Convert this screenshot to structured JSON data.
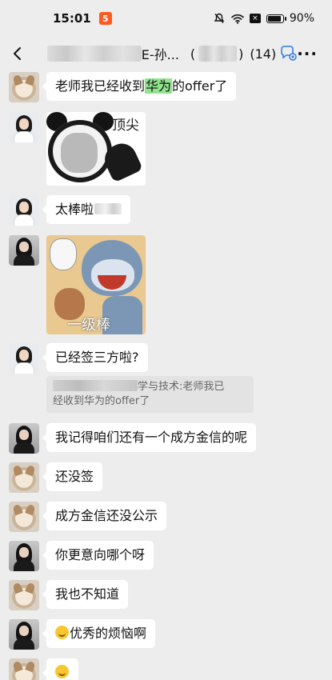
{
  "status_bar": {
    "time": "15:01",
    "app_badge": "5",
    "battery": "90%",
    "battery_level": 0.9,
    "x_glyph": "×"
  },
  "header": {
    "title": "E-孙...",
    "open_paren": "(",
    "close_paren": ")",
    "member_count": "(14)",
    "more": "···"
  },
  "messages": {
    "m1": {
      "before": "老师我已经收到",
      "highlight": "华为",
      "after": "的offer了"
    },
    "m2": {
      "sticker_caption": "顶尖"
    },
    "m3": {
      "text": "太棒啦"
    },
    "m4": {
      "sticker_caption": "一级棒"
    },
    "m5": {
      "text": "已经签三方啦?"
    },
    "m5_quote": {
      "sender_suffix": "学与技术",
      "line1": ":老师我已",
      "line2": "经收到华为的offer了"
    },
    "m6": {
      "text": "我记得咱们还有一个成方金信的呢"
    },
    "m7": {
      "text": "还没签"
    },
    "m8": {
      "text": "成方金信还没公示"
    },
    "m9": {
      "text": "你更意向哪个呀"
    },
    "m10": {
      "text": "我也不知道"
    },
    "m11": {
      "text": "优秀的烦恼啊"
    }
  },
  "colors": {
    "background": "#ededed",
    "bubble": "#ffffff",
    "highlight": "#91e38e",
    "app_badge": "#ff5a1f"
  },
  "icons": [
    "back-chevron-icon",
    "group-chat-icon",
    "more-icon",
    "mute-bell-icon",
    "wifi-icon",
    "battery-icon",
    "smile-emoji-icon"
  ]
}
